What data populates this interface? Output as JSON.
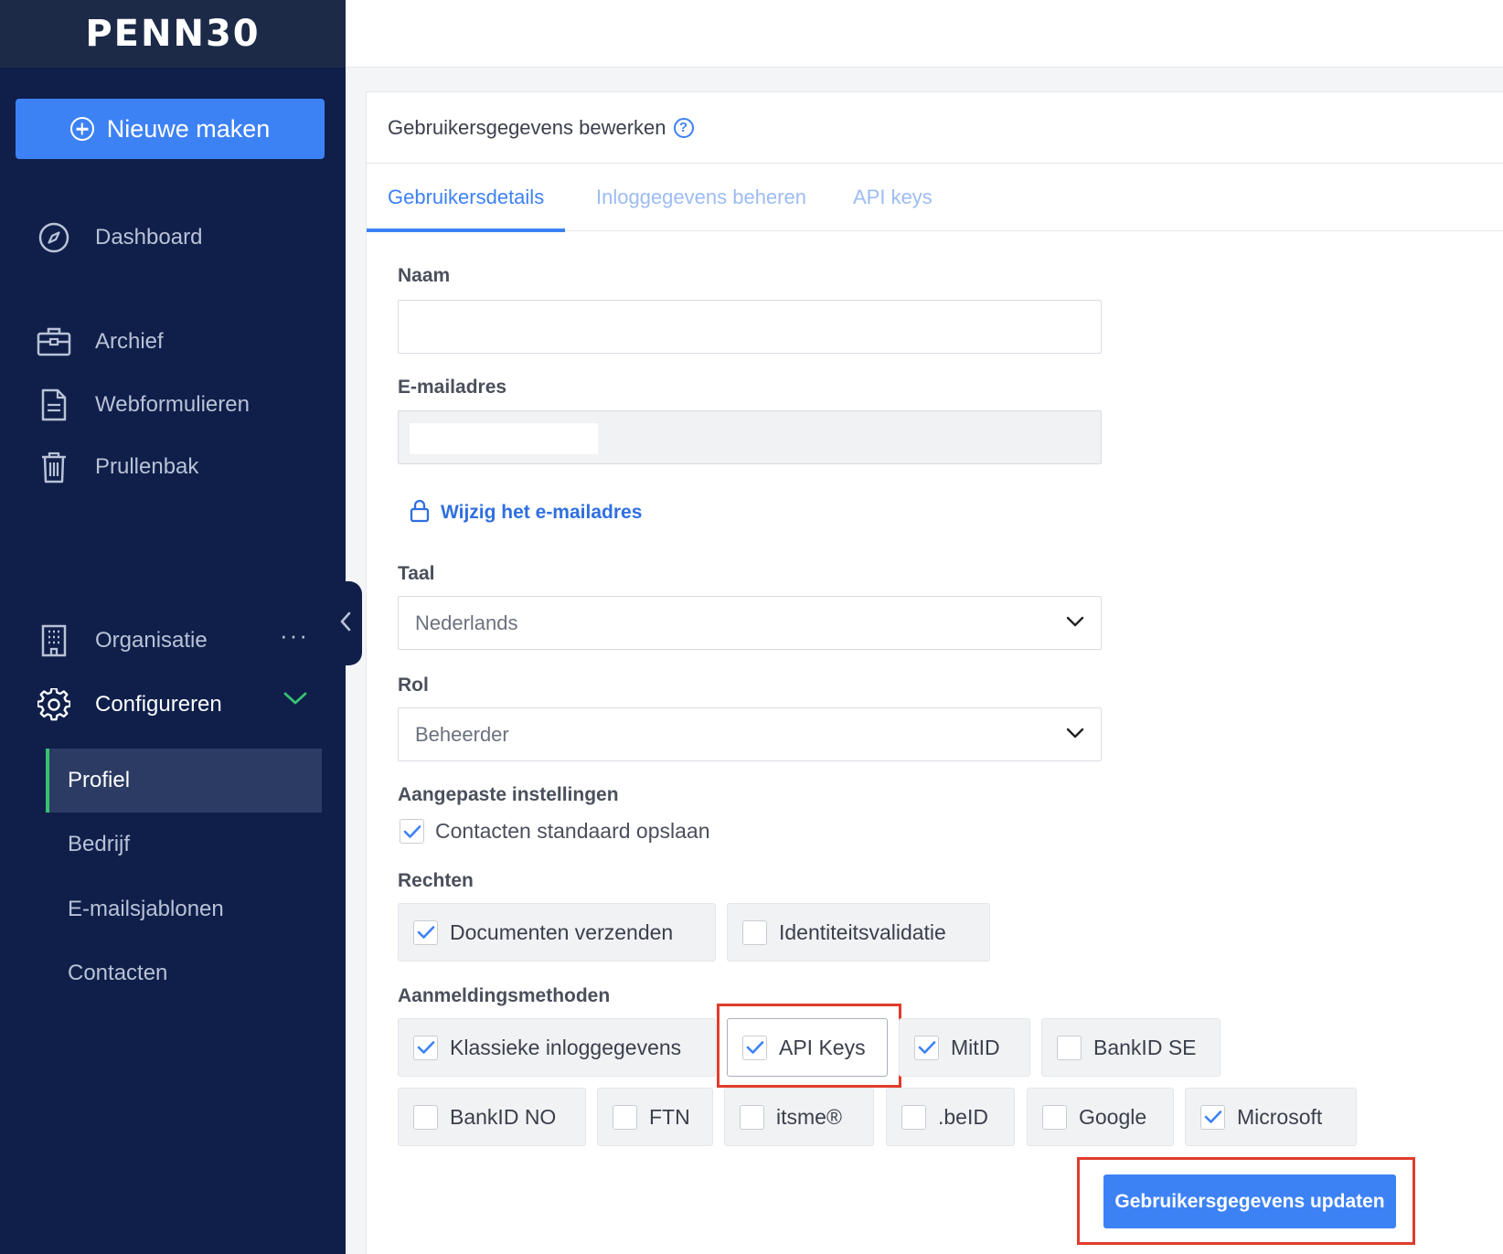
{
  "app": {
    "logo": "PENN30"
  },
  "sidebar": {
    "new_button": "Nieuwe maken",
    "items": {
      "dashboard": "Dashboard",
      "archief": "Archief",
      "webformulieren": "Webformulieren",
      "prullenbak": "Prullenbak",
      "organisatie": "Organisatie",
      "organisatie_more": "···",
      "configureren": "Configureren"
    },
    "subitems": {
      "profiel": "Profiel",
      "bedrijf": "Bedrijf",
      "emailsjablonen": "E-mailsjablonen",
      "contacten": "Contacten"
    }
  },
  "card": {
    "title": "Gebruikersgegevens bewerken",
    "help": "?",
    "tabs": {
      "details": "Gebruikersdetails",
      "login": "Inloggegevens beheren",
      "api": "API keys"
    }
  },
  "form": {
    "name_label": "Naam",
    "name_value": "",
    "email_label": "E-mailadres",
    "email_value": "",
    "change_email_link": "Wijzig het e-mailadres",
    "language_label": "Taal",
    "language_value": "Nederlands",
    "role_label": "Rol",
    "role_value": "Beheerder",
    "custom_settings_label": "Aangepaste instellingen",
    "save_contacts": {
      "label": "Contacten standaard opslaan",
      "checked": true
    },
    "rights_label": "Rechten",
    "rights": {
      "send_documents": {
        "label": "Documenten verzenden",
        "checked": true
      },
      "identity_validation": {
        "label": "Identiteitsvalidatie",
        "checked": false
      }
    },
    "methods_label": "Aanmeldingsmethoden",
    "methods": {
      "classic": {
        "label": "Klassieke inloggegevens",
        "checked": true
      },
      "api_keys": {
        "label": "API Keys",
        "checked": true
      },
      "mitid": {
        "label": "MitID",
        "checked": true
      },
      "bankid_se": {
        "label": "BankID SE",
        "checked": false
      },
      "bankid_no": {
        "label": "BankID NO",
        "checked": false
      },
      "ftn": {
        "label": "FTN",
        "checked": false
      },
      "itsme": {
        "label": "itsme®",
        "checked": false
      },
      "beid": {
        "label": ".beID",
        "checked": false
      },
      "google": {
        "label": "Google",
        "checked": false
      },
      "microsoft": {
        "label": "Microsoft",
        "checked": true
      }
    },
    "submit_label": "Gebruikersgegevens updaten"
  },
  "colors": {
    "sidebar_bg": "#0f1f4a",
    "accent": "#3d82f5",
    "active_indicator": "#38c172",
    "highlight_box": "#e03c2c"
  }
}
